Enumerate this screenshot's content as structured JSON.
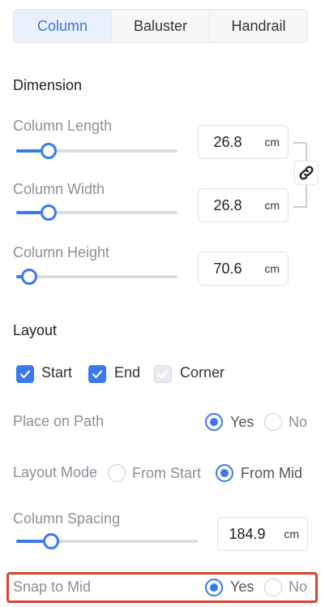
{
  "tabs": [
    {
      "label": "Column",
      "active": true
    },
    {
      "label": "Baluster",
      "active": false
    },
    {
      "label": "Handrail",
      "active": false
    }
  ],
  "dimension": {
    "title": "Dimension",
    "length": {
      "label": "Column Length",
      "value": "26.8",
      "unit": "cm",
      "slider_fraction": 0.2
    },
    "width": {
      "label": "Column Width",
      "value": "26.8",
      "unit": "cm",
      "slider_fraction": 0.2
    },
    "height": {
      "label": "Column Height",
      "value": "70.6",
      "unit": "cm",
      "slider_fraction": 0.08
    },
    "link_icon": "link-icon"
  },
  "layout": {
    "title": "Layout",
    "checkboxes": [
      {
        "label": "Start",
        "checked": true
      },
      {
        "label": "End",
        "checked": true
      },
      {
        "label": "Corner",
        "checked": true,
        "disabled": true
      }
    ],
    "place_on_path": {
      "label": "Place on Path",
      "options": [
        "Yes",
        "No"
      ],
      "selected": "Yes"
    },
    "layout_mode": {
      "label": "Layout Mode",
      "options": [
        "From Start",
        "From Mid"
      ],
      "selected": "From Mid"
    },
    "column_spacing": {
      "label": "Column Spacing",
      "value": "184.9",
      "unit": "cm",
      "slider_fraction": 0.19
    },
    "snap_to_mid": {
      "label": "Snap to Mid",
      "options": [
        "Yes",
        "No"
      ],
      "selected": "Yes",
      "highlighted": true
    }
  },
  "colors": {
    "accent": "#3a78f2",
    "highlight": "#d9432f"
  }
}
